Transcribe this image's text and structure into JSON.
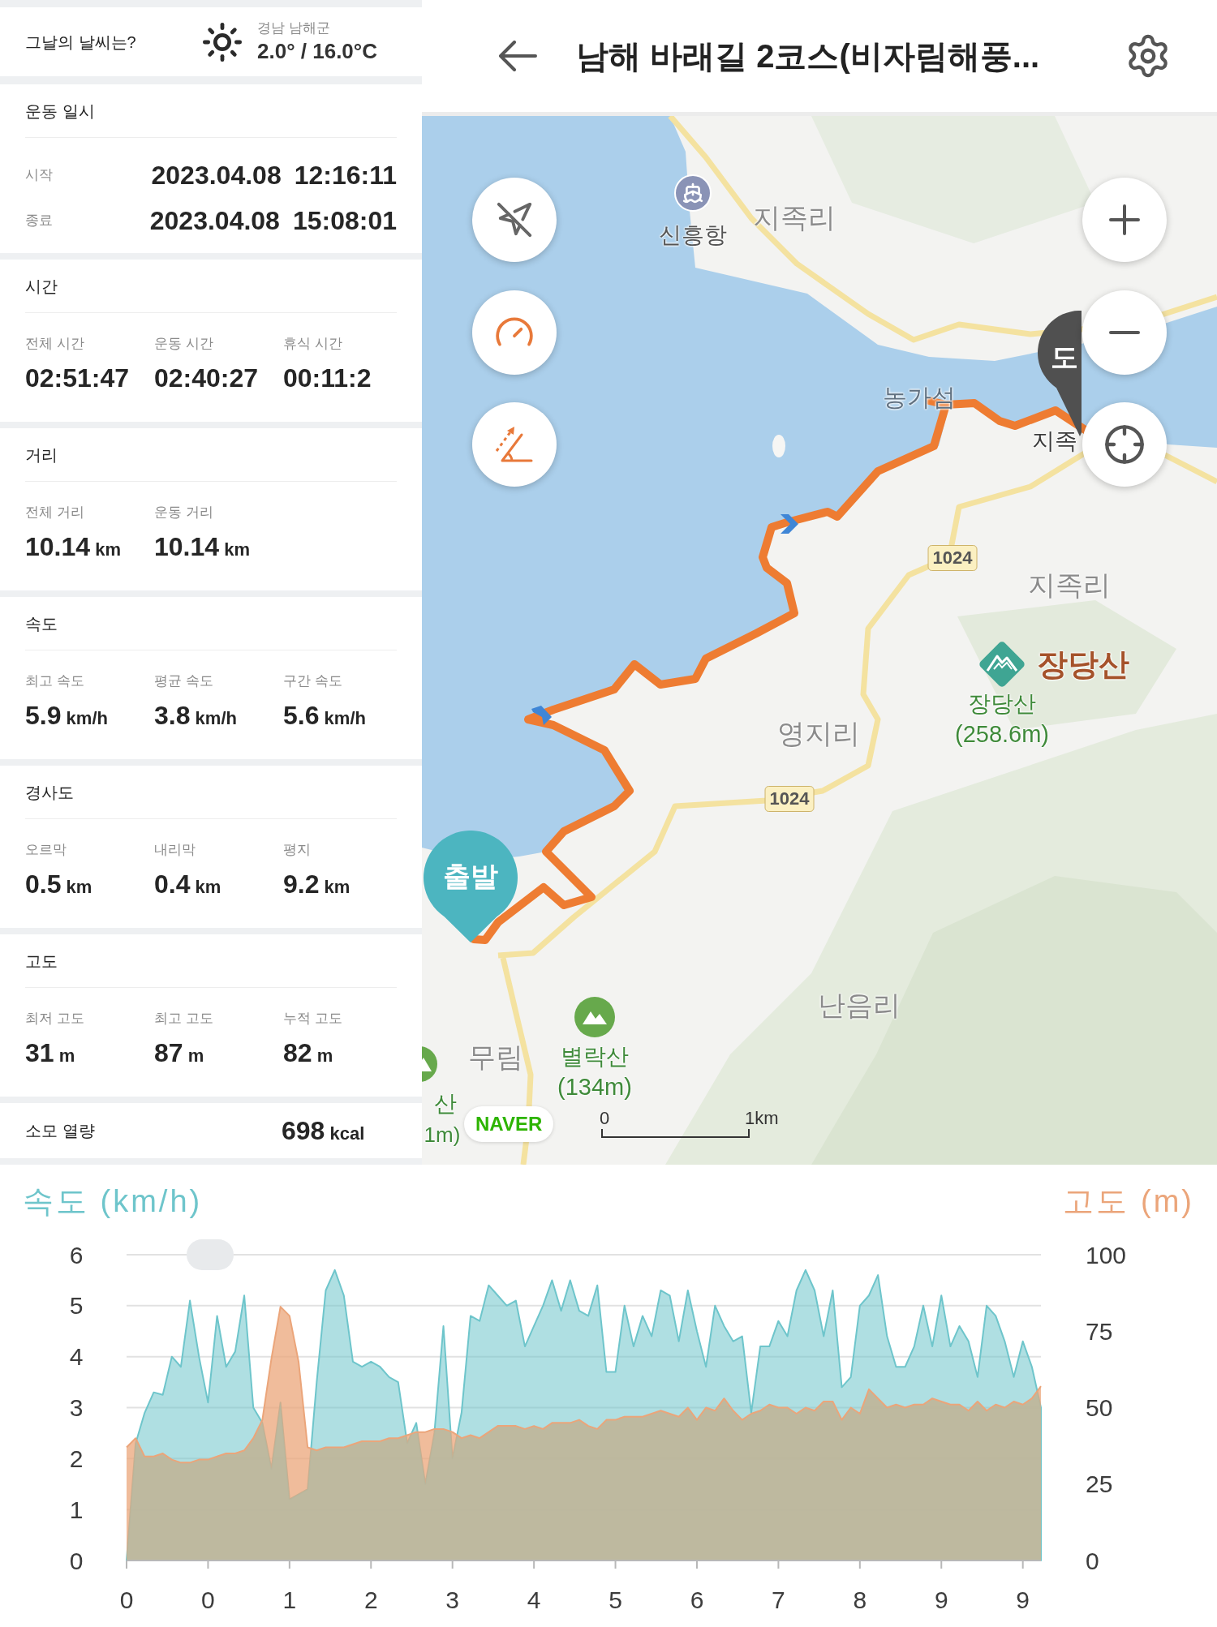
{
  "weather": {
    "label": "그날의 날씨는?",
    "region": "경남 남해군",
    "temperature": "2.0° / 16.0°C"
  },
  "sections": [
    {
      "kind": "datetime",
      "title": "운동 일시",
      "rows": [
        {
          "label": "시작",
          "date": "2023.04.08",
          "time": "12:16:11"
        },
        {
          "label": "종료",
          "date": "2023.04.08",
          "time": "15:08:01"
        }
      ]
    },
    {
      "kind": "stats",
      "title": "시간",
      "items": [
        {
          "label": "전체 시간",
          "value": "02:51:47"
        },
        {
          "label": "운동 시간",
          "value": "02:40:27"
        },
        {
          "label": "휴식 시간",
          "value": "00:11:2"
        }
      ]
    },
    {
      "kind": "stats",
      "title": "거리",
      "items": [
        {
          "label": "전체 거리",
          "value": "10.14",
          "unit": "km"
        },
        {
          "label": "운동 거리",
          "value": "10.14",
          "unit": "km"
        }
      ]
    },
    {
      "kind": "stats",
      "title": "속도",
      "items": [
        {
          "label": "최고 속도",
          "value": "5.9",
          "unit": "km/h"
        },
        {
          "label": "평균 속도",
          "value": "3.8",
          "unit": "km/h"
        },
        {
          "label": "구간 속도",
          "value": "5.6",
          "unit": "km/h"
        }
      ]
    },
    {
      "kind": "stats",
      "title": "경사도",
      "items": [
        {
          "label": "오르막",
          "value": "0.5",
          "unit": "km"
        },
        {
          "label": "내리막",
          "value": "0.4",
          "unit": "km"
        },
        {
          "label": "평지",
          "value": "9.2",
          "unit": "km"
        }
      ]
    },
    {
      "kind": "stats",
      "title": "고도",
      "items": [
        {
          "label": "최저 고도",
          "value": "31",
          "unit": "m"
        },
        {
          "label": "최고 고도",
          "value": "87",
          "unit": "m"
        },
        {
          "label": "누적 고도",
          "value": "82",
          "unit": "m"
        }
      ]
    },
    {
      "kind": "total",
      "title": "소모 열량",
      "value": "698",
      "unit": "kcal"
    }
  ],
  "header": {
    "title": "남해 바래길 2코스(비자림해풍..."
  },
  "map": {
    "port": {
      "name": "신흥항"
    },
    "places": [
      {
        "kind": "village",
        "name": "지족리"
      },
      {
        "kind": "island",
        "name": "농가섬"
      },
      {
        "kind": "harbor",
        "name": "지족"
      },
      {
        "kind": "village",
        "name": "지족리"
      },
      {
        "kind": "village",
        "name": "영지리"
      },
      {
        "kind": "village",
        "name": "난음리"
      },
      {
        "kind": "village",
        "name": "무림"
      }
    ],
    "road_numbers": [
      "1024",
      "1024"
    ],
    "mountains": [
      {
        "kind": "featured",
        "title": "장당산",
        "name": "장당산",
        "height": "(258.6m)"
      },
      {
        "kind": "peak",
        "name": "별락산",
        "height": "(134m)"
      },
      {
        "kind": "edge",
        "name": "산",
        "height": "1m)"
      }
    ],
    "markers": [
      {
        "kind": "start",
        "label": "출발"
      },
      {
        "kind": "end",
        "label": "도"
      }
    ],
    "logo": "NAVER",
    "scale": {
      "start": "0",
      "end": "1km"
    }
  },
  "chart": {
    "chart_data": {
      "type": "area",
      "grid": true,
      "categories": [
        "0",
        null,
        null,
        null,
        null,
        null,
        null,
        null,
        null,
        "0",
        null,
        null,
        null,
        null,
        null,
        null,
        null,
        null,
        "1",
        null,
        null,
        null,
        null,
        null,
        null,
        null,
        null,
        "2",
        null,
        null,
        null,
        null,
        null,
        null,
        null,
        null,
        "3",
        null,
        null,
        null,
        null,
        null,
        null,
        null,
        null,
        "4",
        null,
        null,
        null,
        null,
        null,
        null,
        null,
        null,
        "5",
        null,
        null,
        null,
        null,
        null,
        null,
        null,
        null,
        "6",
        null,
        null,
        null,
        null,
        null,
        null,
        null,
        null,
        "7",
        null,
        null,
        null,
        null,
        null,
        null,
        null,
        null,
        "8",
        null,
        null,
        null,
        null,
        null,
        null,
        null,
        null,
        "9",
        null,
        null,
        null,
        null,
        null,
        null,
        null,
        null,
        "9",
        null,
        null
      ],
      "series": [
        {
          "name": "속도 (km/h)",
          "color": "#6ec5cb",
          "values": [
            0,
            2.3,
            2.9,
            3.3,
            3.25,
            4.0,
            3.8,
            5.1,
            4.0,
            3.1,
            4.8,
            3.8,
            4.1,
            5.2,
            3.0,
            2.7,
            1.8,
            3.1,
            1.2,
            1.3,
            1.4,
            3.5,
            5.3,
            5.7,
            5.2,
            3.9,
            3.8,
            3.9,
            3.8,
            3.6,
            3.5,
            2.3,
            2.7,
            1.5,
            2.5,
            4.6,
            2.0,
            2.9,
            4.8,
            4.7,
            5.4,
            5.2,
            5.0,
            5.1,
            4.2,
            4.6,
            5.0,
            5.5,
            4.9,
            5.5,
            4.9,
            4.8,
            5.4,
            3.7,
            3.7,
            5.0,
            4.2,
            4.8,
            4.4,
            5.3,
            5.2,
            4.3,
            5.3,
            4.5,
            3.8,
            5.0,
            4.6,
            4.3,
            4.4,
            2.9,
            4.2,
            4.2,
            4.7,
            4.4,
            5.3,
            5.7,
            5.3,
            4.4,
            5.3,
            3.4,
            3.6,
            5.0,
            5.2,
            5.6,
            4.4,
            3.8,
            3.8,
            4.2,
            5.0,
            4.2,
            5.2,
            4.2,
            4.6,
            4.3,
            3.6,
            5.0,
            4.8,
            4.3,
            3.6,
            4.3,
            3.8,
            3.0
          ]
        },
        {
          "name": "고도 (m)",
          "axis": "y2",
          "color": "#eba57a",
          "values": [
            37,
            40,
            34,
            34,
            35,
            33,
            32,
            32,
            33,
            33,
            34,
            35,
            35,
            36,
            40,
            46,
            66,
            83,
            80,
            65,
            37,
            36,
            37,
            37,
            37,
            38,
            39,
            39,
            39,
            40,
            40,
            41,
            42,
            42,
            43,
            43,
            42,
            40,
            41,
            40,
            42,
            44,
            44,
            44,
            43,
            44,
            43,
            45,
            45,
            45,
            46,
            44,
            43,
            46,
            46,
            47,
            47,
            47,
            48,
            49,
            48,
            47,
            50,
            46,
            50,
            49,
            53,
            49,
            46,
            48,
            49,
            51,
            50,
            50,
            48,
            50,
            49,
            52,
            52,
            46,
            50,
            48,
            56,
            53,
            50,
            51,
            50,
            51,
            51,
            53,
            52,
            51,
            51,
            49,
            52,
            49,
            51,
            50,
            52,
            51,
            53,
            57
          ]
        }
      ],
      "ylim": [
        0,
        6
      ],
      "yticks": [
        0,
        1,
        2,
        3,
        4,
        5,
        6
      ],
      "y2lim": [
        0,
        100
      ],
      "y2ticks": [
        0,
        25,
        50,
        75,
        100
      ]
    }
  }
}
